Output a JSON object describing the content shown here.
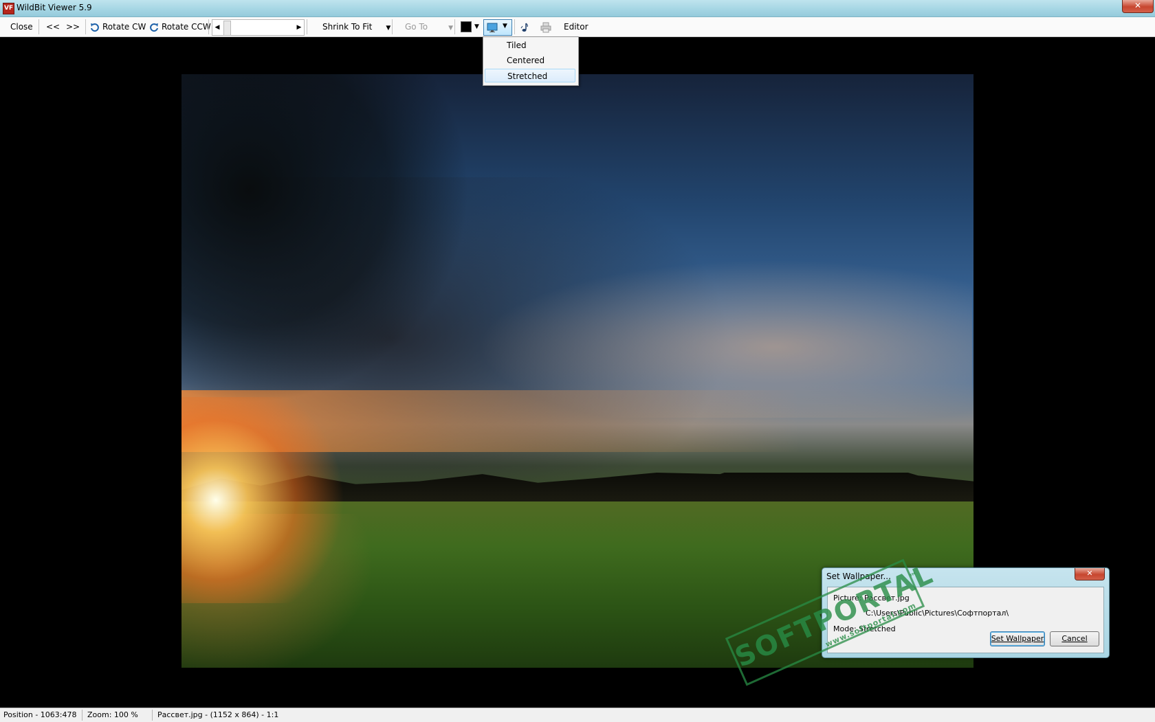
{
  "window": {
    "icon_text": "VF",
    "title": "WildBit Viewer 5.9",
    "close_symbol": "✕"
  },
  "toolbar": {
    "close_label": "Close",
    "prev_label": "<<",
    "next_label": ">>",
    "rotate_cw_label": "Rotate CW",
    "rotate_ccw_label": "Rotate CCW",
    "zoom_mode": "Shrink To Fit",
    "goto_label": "Go To",
    "editor_label": "Editor"
  },
  "wallpaper_menu": {
    "items": [
      "Tiled",
      "Centered",
      "Stretched"
    ],
    "selected": "Stretched"
  },
  "dialog": {
    "title": "Set Wallpaper...",
    "picture_line": "Picture: Рассвет.jpg",
    "path_line": "C:\\Users\\Public\\Pictures\\Софтпортал\\",
    "mode_line": "Mode:   Stretched",
    "set_button": "Set Wallpaper",
    "cancel_button": "Cancel",
    "close_symbol": "✕"
  },
  "watermark": {
    "text": "SOFTPORTAL",
    "sub": "www.softportal.com",
    "tm": "™"
  },
  "statusbar": {
    "position": "Position - 1063:478",
    "zoom": "Zoom: 100 %",
    "file": "Рассвет.jpg -  (1152 x 864) - 1:1"
  },
  "colors": {
    "titlebar": "#a6d6e4",
    "background": "#000000",
    "close_button": "#c7462f",
    "watermark": "#288c46"
  }
}
